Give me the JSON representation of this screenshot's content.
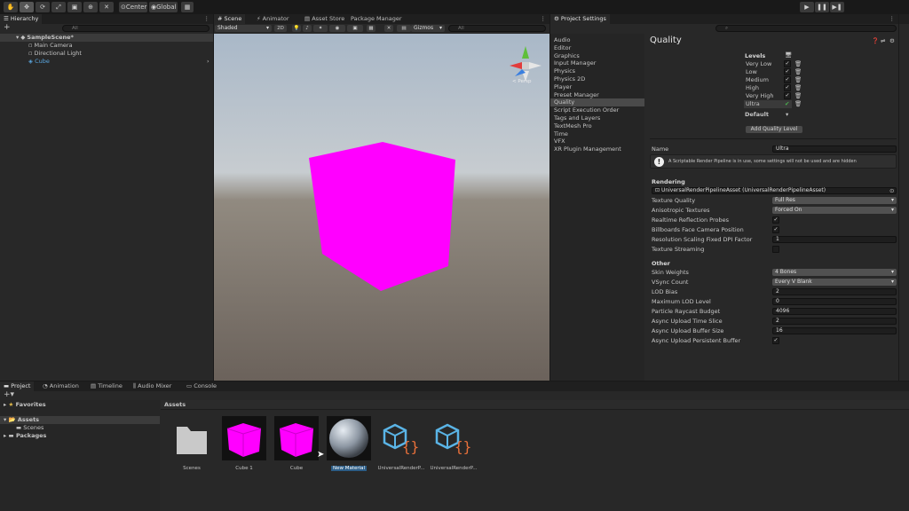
{
  "toolbar": {
    "center_label": "Center",
    "global_label": "Global"
  },
  "hierarchy": {
    "tab": "Hierarchy",
    "add": "+",
    "search_placeholder": "All",
    "scene": "SampleScene*",
    "items": [
      "Main Camera",
      "Directional Light",
      "Cube"
    ]
  },
  "scene_view": {
    "tabs": [
      "Scene",
      "Animator",
      "Asset Store",
      "Package Manager"
    ],
    "shading": "Shaded",
    "mode_2d": "2D",
    "gizmos": "Gizmos",
    "search_placeholder": "All",
    "persp": "< Persp"
  },
  "project_settings": {
    "tab": "Project Settings",
    "categories": [
      "Audio",
      "Editor",
      "Graphics",
      "Input Manager",
      "Physics",
      "Physics 2D",
      "Player",
      "Preset Manager",
      "Quality",
      "Script Execution Order",
      "Tags and Layers",
      "TextMesh Pro",
      "Time",
      "VFX",
      "XR Plugin Management"
    ],
    "selected": "Quality",
    "title": "Quality",
    "levels_label": "Levels",
    "levels": [
      "Very Low",
      "Low",
      "Medium",
      "High",
      "Very High",
      "Ultra"
    ],
    "default_label": "Default",
    "add_level": "Add Quality Level",
    "name_label": "Name",
    "name_value": "Ultra",
    "info": "A Scriptable Render Pipeline is in use, some settings will not be used and are hidden",
    "rendering_header": "Rendering",
    "pipeline_asset": "UniversalRenderPipelineAsset (UniversalRenderPipelineAsset)",
    "rendering": [
      {
        "label": "Texture Quality",
        "type": "dropdown",
        "value": "Full Res"
      },
      {
        "label": "Anisotropic Textures",
        "type": "dropdown",
        "value": "Forced On"
      },
      {
        "label": "Realtime Reflection Probes",
        "type": "check",
        "value": "✓"
      },
      {
        "label": "Billboards Face Camera Position",
        "type": "check",
        "value": "✓"
      },
      {
        "label": "Resolution Scaling Fixed DPI Factor",
        "type": "field",
        "value": "1"
      },
      {
        "label": "Texture Streaming",
        "type": "check",
        "value": ""
      }
    ],
    "other_header": "Other",
    "other": [
      {
        "label": "Skin Weights",
        "type": "dropdown",
        "value": "4 Bones"
      },
      {
        "label": "VSync Count",
        "type": "dropdown",
        "value": "Every V Blank"
      },
      {
        "label": "LOD Bias",
        "type": "field",
        "value": "2"
      },
      {
        "label": "Maximum LOD Level",
        "type": "field",
        "value": "0"
      },
      {
        "label": "Particle Raycast Budget",
        "type": "field",
        "value": "4096"
      },
      {
        "label": "Async Upload Time Slice",
        "type": "field",
        "value": "2"
      },
      {
        "label": "Async Upload Buffer Size",
        "type": "field",
        "value": "16"
      },
      {
        "label": "Async Upload Persistent Buffer",
        "type": "check",
        "value": "✓"
      }
    ]
  },
  "bottom": {
    "tabs": [
      "Project",
      "Animation",
      "Timeline",
      "Audio Mixer",
      "Console"
    ],
    "favorites": "Favorites",
    "assets": "Assets",
    "scenes": "Scenes",
    "packages": "Packages",
    "breadcrumb": "Assets",
    "asset_items": [
      "Scenes",
      "Cube 1",
      "Cube",
      "New Material",
      "UniversalRenderP...",
      "UniversalRenderP..."
    ]
  },
  "colors": {
    "accent": "#2c5d87",
    "cube": "#ff00ff"
  }
}
